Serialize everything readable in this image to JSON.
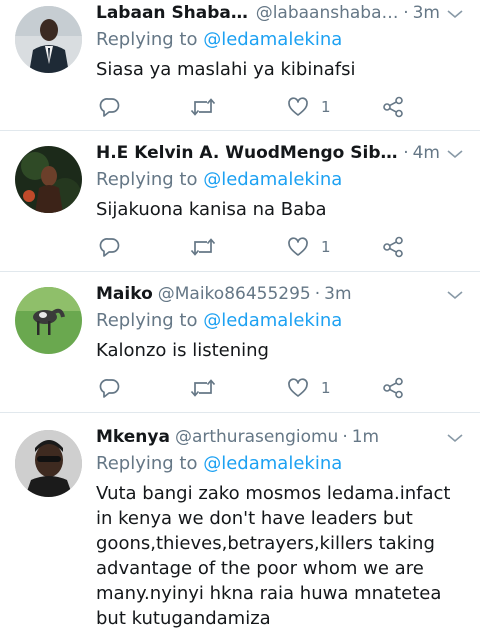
{
  "replying_label": "Replying to",
  "tweets": [
    {
      "name": "Labaan Shabaan",
      "handle": "@labaanshabaan",
      "dot": "·",
      "time": "3m",
      "mention": "@ledamalekina",
      "text": "Siasa ya maslahi ya kibinafsi",
      "likes": "1"
    },
    {
      "name": "H.E Kelvin A. WuodMengo Sibuor J...",
      "handle": "",
      "dot": "·",
      "time": "4m",
      "mention": "@ledamalekina",
      "text": "Sijakuona kanisa na Baba",
      "likes": "1"
    },
    {
      "name": "Maiko",
      "handle": "@Maiko86455295",
      "dot": "·",
      "time": "3m",
      "mention": "@ledamalekina",
      "text": "Kalonzo is listening",
      "likes": "1"
    },
    {
      "name": "Mkenya",
      "handle": "@arthurasengiomu",
      "dot": "·",
      "time": "1m",
      "mention": "@ledamalekina",
      "text": "Vuta bangi zako mosmos ledama.infact in kenya we don't have leaders but goons,thieves,betrayers,killers taking advantage of the poor whom we are many.nyinyi hkna raia huwa mnatetea but kutugandamiza",
      "likes": ""
    }
  ],
  "colors": {
    "accent": "#1da1f2",
    "secondary_text": "#657786",
    "primary_text": "#14171a",
    "divider": "#e1e8ed"
  },
  "icons": [
    "reply-icon",
    "retweet-icon",
    "like-icon",
    "share-icon",
    "chevron-down-icon"
  ]
}
